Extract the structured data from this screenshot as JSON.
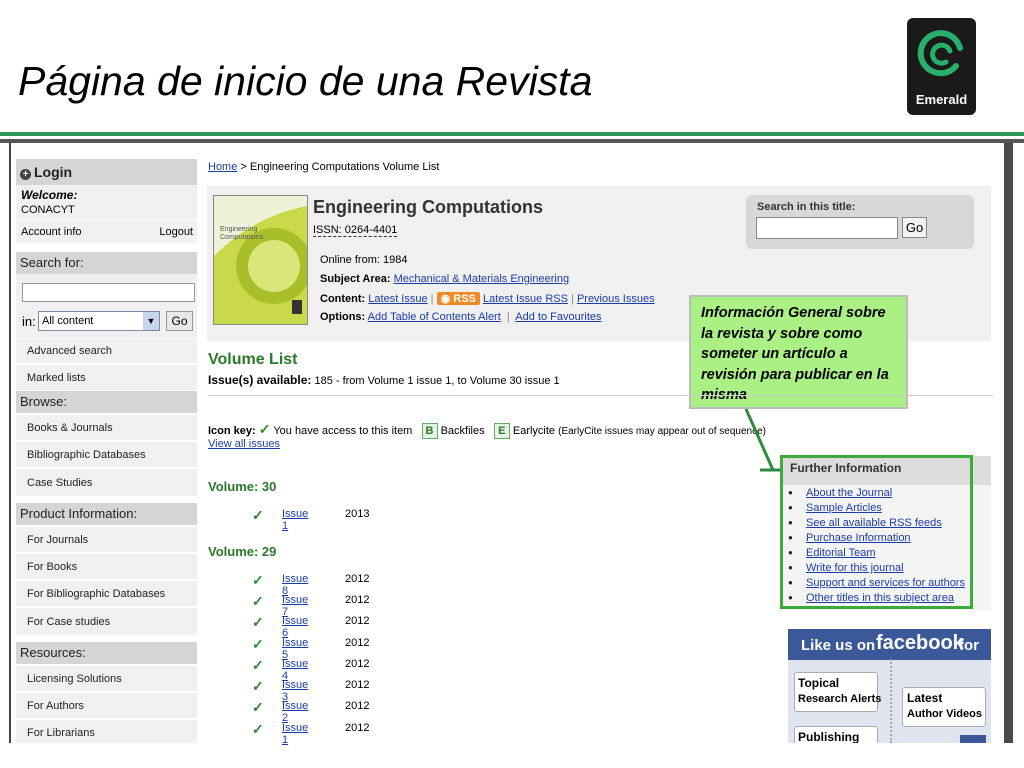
{
  "slide": {
    "title": "Página de inicio de una Revista",
    "logo_text": "Emerald",
    "colors": {
      "accent_green": "#2e9a5a",
      "logo_bg": "#1a1a1a"
    }
  },
  "sidebar": {
    "login": {
      "label": "Login",
      "welcome": "Welcome:",
      "user": "CONACYT",
      "account": "Account info",
      "logout": "Logout"
    },
    "search": {
      "header": "Search for:",
      "in_label": "in:",
      "select_value": "All content",
      "go": "Go",
      "advanced": "Advanced search",
      "marked": "Marked lists"
    },
    "browse": {
      "header": "Browse:",
      "items": [
        "Books & Journals",
        "Bibliographic Databases",
        "Case Studies"
      ]
    },
    "product": {
      "header": "Product Information:",
      "items": [
        "For Journals",
        "For Books",
        "For Bibliographic Databases",
        "For Case studies"
      ]
    },
    "resources": {
      "header": "Resources:",
      "items": [
        "Licensing Solutions",
        "For Authors",
        "For Librarians"
      ]
    }
  },
  "breadcrumb": {
    "home": "Home",
    "sep": ">",
    "current": "Engineering Computations Volume List"
  },
  "journal": {
    "title": "Engineering Computations",
    "issn": "ISSN: 0264-4401",
    "online_from": "Online from: 1984",
    "subject_label": "Subject Area:",
    "subject_value": "Mechanical & Materials Engineering",
    "content_label": "Content:",
    "content_links": [
      "Latest Issue",
      "RSS",
      "Latest Issue RSS",
      "Previous Issues"
    ],
    "options_label": "Options:",
    "options_links": [
      "Add Table of Contents Alert",
      "Add to Favourites"
    ],
    "cover_title": "Engineering Computations"
  },
  "search_title": {
    "label": "Search in this title:",
    "go": "Go",
    "value": ""
  },
  "callout": {
    "text": "Información General sobre la revista y sobre como someter un artículo a revisión para publicar en la misma"
  },
  "volume_list": {
    "heading": "Volume List",
    "issues_label": "Issue(s) available:",
    "issues_text": "185 - from Volume 1 issue 1, to Volume 30 issue 1",
    "icon_key_label": "Icon key:",
    "key_access": "You have access to this item",
    "key_b": "B",
    "key_backfiles": "Backfiles",
    "key_e": "E",
    "key_earlycite": "Earlycite",
    "key_earlycite_note": "(EarlyCite issues may appear out of sequence)",
    "view_all": "View all issues",
    "volumes": [
      {
        "label": "Volume: 30",
        "issues": [
          {
            "name": "Issue 1",
            "year": "2013"
          }
        ]
      },
      {
        "label": "Volume: 29",
        "issues": [
          {
            "name": "Issue 8",
            "year": "2012"
          },
          {
            "name": "Issue 7",
            "year": "2012"
          },
          {
            "name": "Issue 6",
            "year": "2012"
          },
          {
            "name": "Issue 5",
            "year": "2012"
          },
          {
            "name": "Issue 4",
            "year": "2012"
          },
          {
            "name": "Issue 3",
            "year": "2012"
          },
          {
            "name": "Issue 2",
            "year": "2012"
          },
          {
            "name": "Issue 1",
            "year": "2012"
          }
        ]
      }
    ]
  },
  "further_info": {
    "heading": "Further Information",
    "items": [
      "About the Journal",
      "Sample Articles",
      "See all available RSS feeds",
      "Purchase Information",
      "Editorial Team",
      "Write for this journal",
      "Support and services for authors",
      "Other titles in this subject area"
    ]
  },
  "facebook": {
    "like_text": "Like us on",
    "brand": "facebook",
    "for_text": "for",
    "topical": "Topical",
    "research_alerts": "Research Alerts",
    "latest": "Latest",
    "author_videos": "Author Videos",
    "publishing": "Publishing"
  }
}
